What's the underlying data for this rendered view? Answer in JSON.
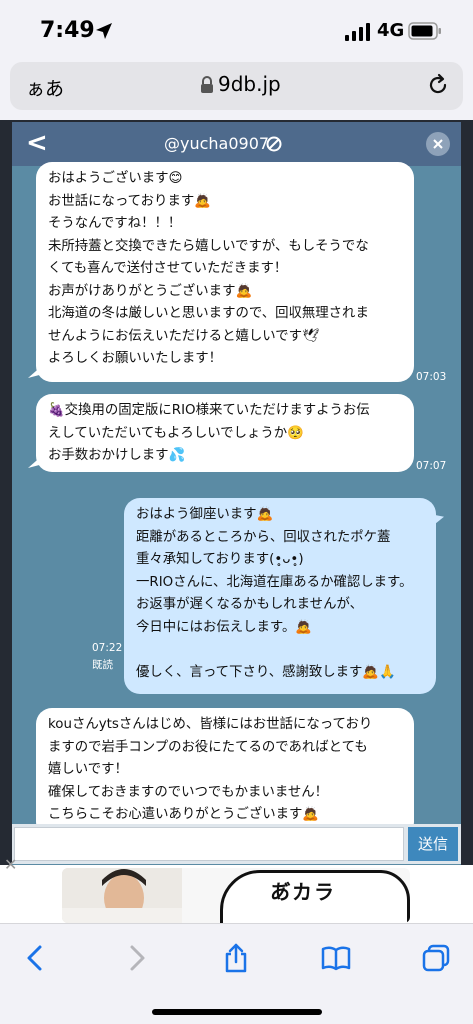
{
  "status_bar": {
    "time": "7:49",
    "network": "4G"
  },
  "browser": {
    "aa_label": "ぁあ",
    "url": "9db.jp"
  },
  "chat": {
    "username": "@yucha0907",
    "back_label": "<",
    "messages": [
      {
        "direction": "received",
        "time": "07:03",
        "lines": [
          "おはようございます😊",
          "お世話になっております🙇",
          "そうなんですね！！！",
          "未所持蓋と交換できたら嬉しいですが、もしそうでな",
          "くても喜んで送付させていただきます！",
          "お声がけありがとうございます🙇",
          "北海道の冬は厳しいと思いますので、回収無理されま",
          "せんようにお伝えいただけると嬉しいです🕊",
          "よろしくお願いいたします！"
        ]
      },
      {
        "direction": "received",
        "time": "07:07",
        "lines": [
          "🍇交換用の固定版にRIO様来ていただけますようお伝",
          "えしていただいてもよろしいでしょうか🥺",
          "お手数おかけします💦"
        ]
      },
      {
        "direction": "sent",
        "time": "07:22",
        "read": "既読",
        "lines": [
          "おはよう御座います🙇",
          "距離があるところから、回収されたポケ蓋",
          "重々承知しております(•̥ᴗ•̥)",
          "一RIOさんに、北海道在庫あるか確認します。",
          "お返事が遅くなるかもしれませんが、",
          "今日中にはお伝えします。🙇",
          "",
          "優しく、言って下さり、感謝致します🙇🙏"
        ]
      },
      {
        "direction": "received",
        "time": "",
        "lines": [
          "kouさんytsさんはじめ、皆様にはお世話になっており",
          "ますので岩手コンプのお役にたてるのであればとても",
          "嬉しいです！",
          "確保しておきますのでいつでもかまいません！",
          "こちらこそお心遣いありがとうございます🙇"
        ]
      }
    ],
    "send_label": "送信"
  },
  "ad": {
    "text": "あ゙カラ"
  },
  "colors": {
    "chat_bg": "#5b8ba4",
    "header_bg": "#4e6a8c",
    "sent_bubble": "#cfe8ff",
    "send_button": "#3e88bd",
    "ios_blue": "#1a73e8"
  },
  "icons": {
    "location": "location-arrow-icon",
    "lock": "lock-icon",
    "reload": "reload-icon",
    "block": "block-icon",
    "close": "close-icon",
    "back": "chevron-left-icon",
    "forward": "chevron-right-icon",
    "share": "share-icon",
    "bookmarks": "book-icon",
    "tabs": "tabs-icon"
  }
}
